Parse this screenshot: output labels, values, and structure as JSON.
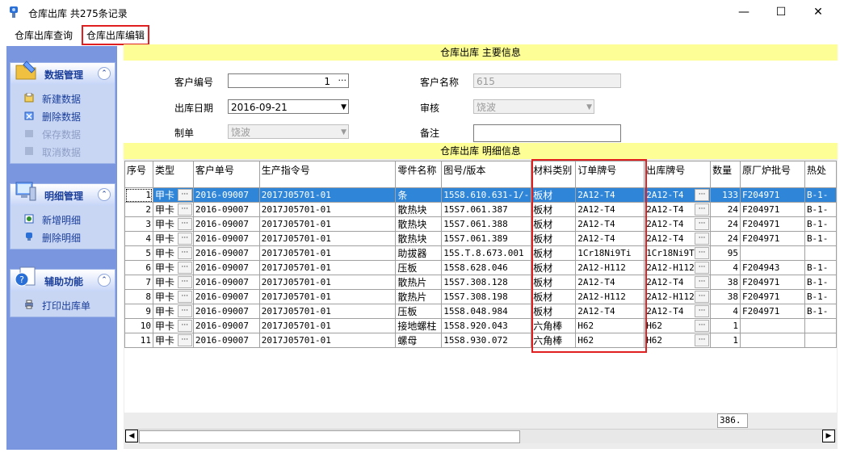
{
  "window": {
    "title": "仓库出库 共275条记录",
    "minimize": "—",
    "maximize": "☐",
    "close": "✕"
  },
  "menu": {
    "items": [
      "仓库出库查询",
      "仓库出库编辑"
    ],
    "active_index": 1
  },
  "sidebar": {
    "panels": [
      {
        "title": "数据管理",
        "collapse": "⌃",
        "items": [
          {
            "label": "新建数据",
            "enabled": true
          },
          {
            "label": "删除数据",
            "enabled": true
          },
          {
            "label": "保存数据",
            "enabled": false
          },
          {
            "label": "取消数据",
            "enabled": false
          }
        ]
      },
      {
        "title": "明细管理",
        "collapse": "⌃",
        "items": [
          {
            "label": "新增明细",
            "enabled": true
          },
          {
            "label": "删除明细",
            "enabled": true
          }
        ]
      },
      {
        "title": "辅助功能",
        "collapse": "⌃",
        "items": [
          {
            "label": "打印出库单",
            "enabled": true
          }
        ]
      }
    ]
  },
  "main_info": {
    "header": "仓库出库  主要信息",
    "customer_no_label": "客户编号",
    "customer_no_value": "1",
    "customer_name_label": "客户名称",
    "customer_name_value": "615",
    "date_label": "出库日期",
    "date_value": "2016-09-21",
    "review_label": "审核",
    "review_value": "饶波",
    "maker_label": "制单",
    "maker_value": "饶波",
    "remark_label": "备注",
    "remark_value": ""
  },
  "detail": {
    "header": "仓库出库  明细信息",
    "columns": [
      "序号",
      "类型",
      "客户单号",
      "生产指令号",
      "零件名称",
      "图号/版本",
      "材料类别",
      "订单牌号",
      "出库牌号",
      "数量",
      "原厂炉批号",
      "热处"
    ],
    "rows": [
      [
        "1",
        "甲卡",
        "2016-09007",
        "2017J05701-01",
        "条",
        "15S8.610.631-1/-",
        "板材",
        "2A12-T4",
        "2A12-T4",
        "133",
        "F204971",
        "B-1-"
      ],
      [
        "2",
        "甲卡",
        "2016-09007",
        "2017J05701-01",
        "散热块",
        "15S7.061.387",
        "板材",
        "2A12-T4",
        "2A12-T4",
        "24",
        "F204971",
        "B-1-"
      ],
      [
        "3",
        "甲卡",
        "2016-09007",
        "2017J05701-01",
        "散热块",
        "15S7.061.388",
        "板材",
        "2A12-T4",
        "2A12-T4",
        "24",
        "F204971",
        "B-1-"
      ],
      [
        "4",
        "甲卡",
        "2016-09007",
        "2017J05701-01",
        "散热块",
        "15S7.061.389",
        "板材",
        "2A12-T4",
        "2A12-T4",
        "24",
        "F204971",
        "B-1-"
      ],
      [
        "5",
        "甲卡",
        "2016-09007",
        "2017J05701-01",
        "助拔器",
        "15S.T.8.673.001",
        "板材",
        "1Cr18Ni9Ti",
        "1Cr18Ni9T",
        "95",
        "",
        ""
      ],
      [
        "6",
        "甲卡",
        "2016-09007",
        "2017J05701-01",
        "压板",
        "15S8.628.046",
        "板材",
        "2A12-H112",
        "2A12-H112",
        "4",
        "F204943",
        "B-1-"
      ],
      [
        "7",
        "甲卡",
        "2016-09007",
        "2017J05701-01",
        "散热片",
        "15S7.308.128",
        "板材",
        "2A12-T4",
        "2A12-T4",
        "38",
        "F204971",
        "B-1-"
      ],
      [
        "8",
        "甲卡",
        "2016-09007",
        "2017J05701-01",
        "散热片",
        "15S7.308.198",
        "板材",
        "2A12-H112",
        "2A12-H112",
        "38",
        "F204971",
        "B-1-"
      ],
      [
        "9",
        "甲卡",
        "2016-09007",
        "2017J05701-01",
        "压板",
        "15S8.048.984",
        "板材",
        "2A12-T4",
        "2A12-T4",
        "4",
        "F204971",
        "B-1-"
      ],
      [
        "10",
        "甲卡",
        "2016-09007",
        "2017J05701-01",
        "接地螺柱",
        "15S8.920.043",
        "六角棒",
        "H62",
        "H62",
        "1",
        "",
        ""
      ],
      [
        "11",
        "甲卡",
        "2016-09007",
        "2017J05701-01",
        "螺母",
        "15S8.930.072",
        "六角棒",
        "H62",
        "H62",
        "1",
        "",
        ""
      ]
    ],
    "selected_row": 0,
    "total_quantity": "386."
  },
  "colors": {
    "sidebar_bg": "#7a96df",
    "section_bar": "#fefe96",
    "selection": "#2f86d9",
    "highlight": "#e02020"
  }
}
